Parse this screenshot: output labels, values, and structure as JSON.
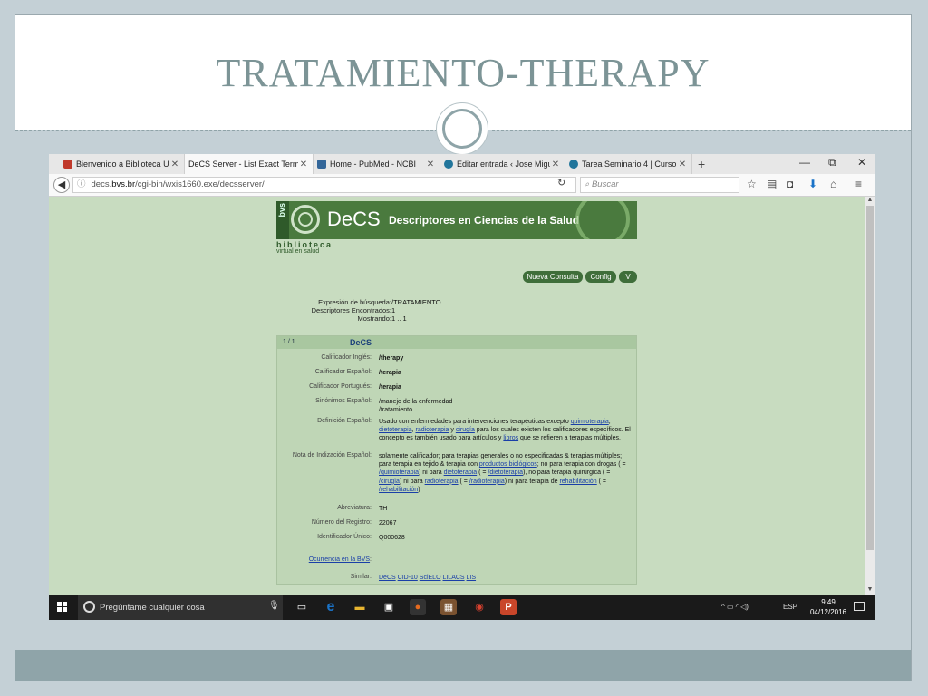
{
  "slide": {
    "title": "TRATAMIENTO-THERAPY"
  },
  "browser": {
    "tabs": [
      {
        "label": "Bienvenido a Biblioteca U...",
        "icon": "library-icon",
        "color": "#c0392b"
      },
      {
        "label": "DeCS Server - List Exact Term",
        "icon": "page-icon",
        "color": "#ffffff"
      },
      {
        "label": "Home - PubMed - NCBI",
        "icon": "ncbi-icon",
        "color": "#336699"
      },
      {
        "label": "Editar entrada ‹ Jose Migu...",
        "icon": "wordpress-icon",
        "color": "#21759b"
      },
      {
        "label": "Tarea Seminario 4 | Curso ...",
        "icon": "wordpress-icon",
        "color": "#21759b"
      }
    ],
    "new_tab": "+",
    "window_controls": [
      "—",
      "⧉",
      "✕"
    ],
    "url_prefix": "decs.",
    "url_domain": "bvs.br",
    "url_path": "/cgi-bin/wxis1660.exe/decsserver/",
    "search_placeholder": "Buscar",
    "nav_icons": [
      "☆",
      "▤",
      "◘",
      "⬇",
      "⌂",
      "≡"
    ]
  },
  "page": {
    "banner": {
      "bvs": "bvs",
      "decs": "DeCS",
      "description": "Descriptores en Ciencias de la Salud"
    },
    "biblioteca": "biblioteca",
    "virtual": "virtual en salud",
    "buttons": [
      {
        "label": "Nueva Consulta"
      },
      {
        "label": "Config"
      },
      {
        "label": "V"
      }
    ],
    "search_summary": [
      {
        "label": "Expresión de búsqueda:",
        "value": "/TRATAMIENTO"
      },
      {
        "label": "Descriptores Encontrados:",
        "value": "1"
      },
      {
        "label": "Mostrando:",
        "value": "1 .. 1"
      }
    ],
    "record": {
      "position": "1 / 1",
      "header": "DeCS",
      "calificador_ingles_label": "Calificador Inglés:",
      "calificador_ingles": "/therapy",
      "calificador_espanol_label": "Calificador Español:",
      "calificador_espanol": "/terapia",
      "calificador_portugues_label": "Calificador Portugués:",
      "calificador_portugues": "/terapia",
      "sinonimos_label": "Sinónimos Español:",
      "sinonimos": [
        "/manejo de la enfermedad",
        "/tratamiento"
      ],
      "definicion_label": "Definición Español:",
      "definicion": {
        "p1": "Usado con enfermedades para intervenciones terapéuticas excepto",
        "l1": "quimioterapia",
        "s1": ", ",
        "l2": "dietoterapia",
        "s2": ", ",
        "l3": "radioterapia",
        "s3": " y ",
        "l4": "cirugía",
        "p2": " para los cuales existen los calificadores específicos. El concepto es también usado para artículos y ",
        "l5": "libros",
        "p3": " que se refieren a terapias múltiples."
      },
      "nota_label": "Nota de Indización Español:",
      "nota": {
        "p1": "solamente calificador; para terapias generales o no especificadas & terapias múltiples; para terapia en tejido & terapia con ",
        "l1": "productos biológicos",
        "p2": "; no para terapia con drogas ( = ",
        "l2": "/quimioterapia",
        "p3": ") ni para ",
        "l3": "dietoterapia",
        "p4": " ( = ",
        "l4": "/dietoterapia",
        "p5": "), no para terapia quirúrgica ( = ",
        "l5": "/cirugía",
        "p6": ") ni para ",
        "l6": "radioterapia",
        "p7": " ( = ",
        "l7": "/radioterapia",
        "p8": ") ni para terapia de ",
        "l8": "rehabilitación",
        "p9": " ( = ",
        "l9": "/rehabilitación",
        "p10": ")"
      },
      "abreviatura_label": "Abreviatura:",
      "abreviatura": "TH",
      "registro_label": "Número del Registro:",
      "registro": "22067",
      "identificador_label": "Identificador Único:",
      "identificador": "Q000628",
      "ocurrencia": "Ocurrencia en la BVS",
      "ocurrencia_colon": ":",
      "similar_label": "Similar:",
      "similar": [
        "DeCS",
        "CID-10",
        "SciELO",
        "LILACS",
        "LIS"
      ]
    }
  },
  "taskbar": {
    "search_text": "Pregúntame cualquier cosa",
    "apps": [
      {
        "name": "task-view-icon",
        "glyph": "▭",
        "color": "#1a1a1a"
      },
      {
        "name": "edge-icon",
        "glyph": "e",
        "color": "#1a73c8"
      },
      {
        "name": "file-explorer-icon",
        "glyph": "▬",
        "color": "#e8b530"
      },
      {
        "name": "store-icon",
        "glyph": "▣",
        "color": "#444444"
      },
      {
        "name": "firefox-icon",
        "glyph": "●",
        "color": "#e66b1f"
      },
      {
        "name": "app-icon",
        "glyph": "▦",
        "color": "#7a5230"
      },
      {
        "name": "chrome-icon",
        "glyph": "◉",
        "color": "#d8412f"
      },
      {
        "name": "powerpoint-icon",
        "glyph": "P",
        "color": "#c9462a"
      }
    ],
    "tray": "^ ▭ ◜ ◁) ",
    "language": "ESP",
    "time": "9:49",
    "date": "04/12/2016"
  }
}
